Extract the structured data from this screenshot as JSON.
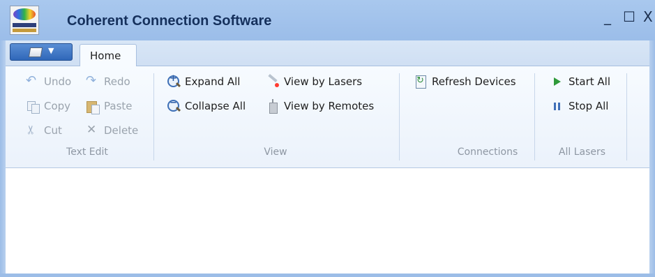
{
  "window": {
    "title": "Coherent Connection Software",
    "controls": {
      "minimize": "_",
      "maximize": "☐",
      "close": "X"
    }
  },
  "tabs": [
    {
      "label": "Home",
      "active": true
    }
  ],
  "ribbon": {
    "text_edit": {
      "label": "Text Edit",
      "undo": "Undo",
      "redo": "Redo",
      "copy": "Copy",
      "paste": "Paste",
      "cut": "Cut",
      "delete": "Delete"
    },
    "view": {
      "label": "View",
      "expand_all": "Expand All",
      "collapse_all": "Collapse All",
      "view_by_lasers": "View by Lasers",
      "view_by_remotes": "View by Remotes"
    },
    "connections": {
      "label": "Connections",
      "refresh_devices": "Refresh Devices"
    },
    "all_lasers": {
      "label": "All Lasers",
      "start_all": "Start All",
      "stop_all": "Stop All"
    }
  },
  "icons": {
    "app_logo": "coherent-logo-icon",
    "undo": "undo-icon",
    "redo": "redo-icon",
    "copy": "copy-icon",
    "paste": "paste-icon",
    "cut": "scissors-icon",
    "delete": "x-icon",
    "expand_all": "zoom-in-icon",
    "collapse_all": "zoom-out-icon",
    "view_by_lasers": "laser-icon",
    "view_by_remotes": "remote-icon",
    "refresh_devices": "refresh-document-icon",
    "start_all": "play-icon",
    "stop_all": "pause-icon"
  },
  "colors": {
    "titlebar": "#a9c8ee",
    "title_text": "#15305c",
    "app_menu_button": "#2f67b9",
    "ribbon_background": "#f7fbff",
    "disabled_text": "#9aa3ad",
    "group_label_text": "#8e97a3"
  }
}
